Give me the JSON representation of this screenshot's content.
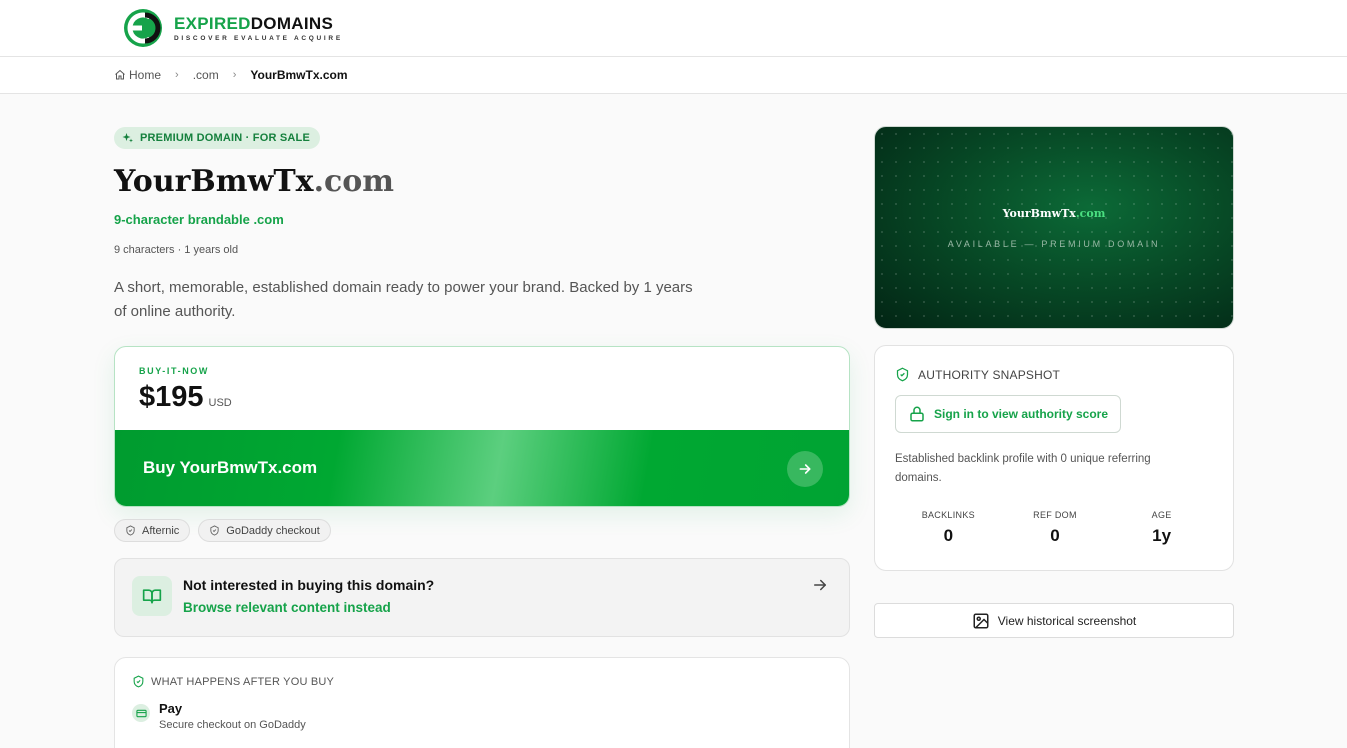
{
  "header": {
    "logo_word1": "EXPIRED",
    "logo_word2": "DOMAINS",
    "logo_tagline": "DISCOVER EVALUATE ACQUIRE"
  },
  "breadcrumbs": [
    "Home",
    ".com",
    "YourBmwTx.com"
  ],
  "listing": {
    "badge": "PREMIUM DOMAIN · FOR SALE",
    "name": "YourBmwTx",
    "tld": ".com",
    "tagline": "9-character brandable .com",
    "meta": "9 characters · 1 years old",
    "description": "A short, memorable, established domain ready to power your brand. Backed by 1 years of online authority."
  },
  "buy": {
    "label": "BUY-IT-NOW",
    "price": "$195",
    "currency": "USD",
    "button_label": "Buy YourBmwTx.com"
  },
  "chips": [
    "Afternic",
    "GoDaddy checkout"
  ],
  "alternative": {
    "question": "Not interested in buying this domain?",
    "link": "Browse relevant content instead"
  },
  "after_buy": {
    "heading": "WHAT HAPPENS AFTER YOU BUY",
    "steps": [
      {
        "title": "Pay",
        "subtitle": "Secure checkout on GoDaddy"
      }
    ]
  },
  "hero": {
    "name": "YourBmwTx",
    "tld": ".com",
    "subtitle": "AVAILABLE — PREMIUM DOMAIN"
  },
  "authority": {
    "heading": "AUTHORITY SNAPSHOT",
    "signin_label": "Sign in to view authority score",
    "description": "Established backlink profile with 0 unique referring domains.",
    "stats": [
      {
        "label": "BACKLINKS",
        "value": "0"
      },
      {
        "label": "REF DOM",
        "value": "0"
      },
      {
        "label": "AGE",
        "value": "1y"
      }
    ]
  },
  "history_button": "View historical screenshot",
  "colors": {
    "brand_green": "#16a34a",
    "buy_button": "#00a832",
    "hero_dark": "#074a26"
  }
}
